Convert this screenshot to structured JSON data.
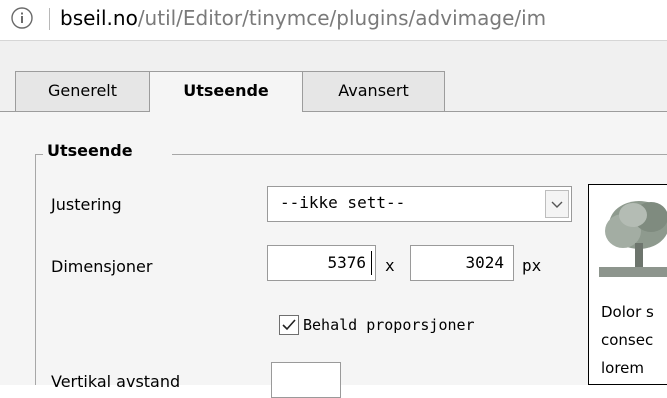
{
  "address_bar": {
    "host": "bseil.no",
    "path": "/util/Editor/tinymce/plugins/advimage/im"
  },
  "icons": {
    "info": "info-icon",
    "dropdown": "chevron-down-icon",
    "checkbox": "checkmark-icon",
    "preview": "tree-icon"
  },
  "tabs": [
    {
      "label": "Generelt",
      "active": false
    },
    {
      "label": "Utseende",
      "active": true
    },
    {
      "label": "Avansert",
      "active": false
    }
  ],
  "fieldset": {
    "legend": "Utseende",
    "alignment": {
      "label": "Justering",
      "value": "--ikke sett--"
    },
    "dimensions": {
      "label": "Dimensjoner",
      "width": "5376",
      "separator": "x",
      "height": "3024",
      "unit": "px"
    },
    "keep_proportions": {
      "label": "Behald proporsjoner",
      "checked": true
    },
    "vertical_space": {
      "label": "Vertikal avstand",
      "value": ""
    }
  },
  "preview": {
    "lines": [
      "Dolor s",
      "consec",
      "lorem"
    ]
  },
  "colors": {
    "panel_bg": "#f5f5f5",
    "tab_bg": "#e6e6e6",
    "border": "#9c9c9c",
    "url_path": "#7a7a7a"
  }
}
